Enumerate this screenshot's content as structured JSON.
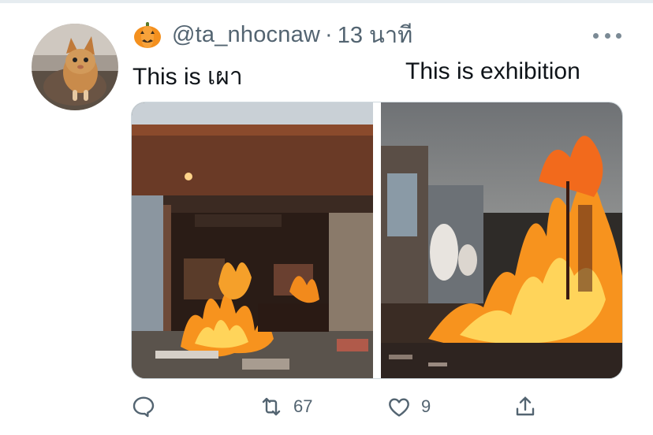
{
  "tweet": {
    "avatar_icon": "cat-avatar",
    "emoji_icon": "pumpkin-icon",
    "handle": "@ta_nhocnaw",
    "separator": "·",
    "time": "13 นาที",
    "more_icon": "more-dots-icon",
    "text_left": "This is เผา",
    "text_right": "This is exhibition"
  },
  "media": {
    "left_photo": "burning subway station entrance",
    "right_photo": "bonfire with effigy at dusk"
  },
  "actions": {
    "reply_icon": "reply-icon",
    "retweet_icon": "retweet-icon",
    "retweet_count": "67",
    "like_icon": "heart-icon",
    "like_count": "9",
    "share_icon": "share-icon"
  },
  "colors": {
    "secondary_text": "#536471",
    "primary_text": "#0f1419",
    "fire": "#f7931e"
  }
}
